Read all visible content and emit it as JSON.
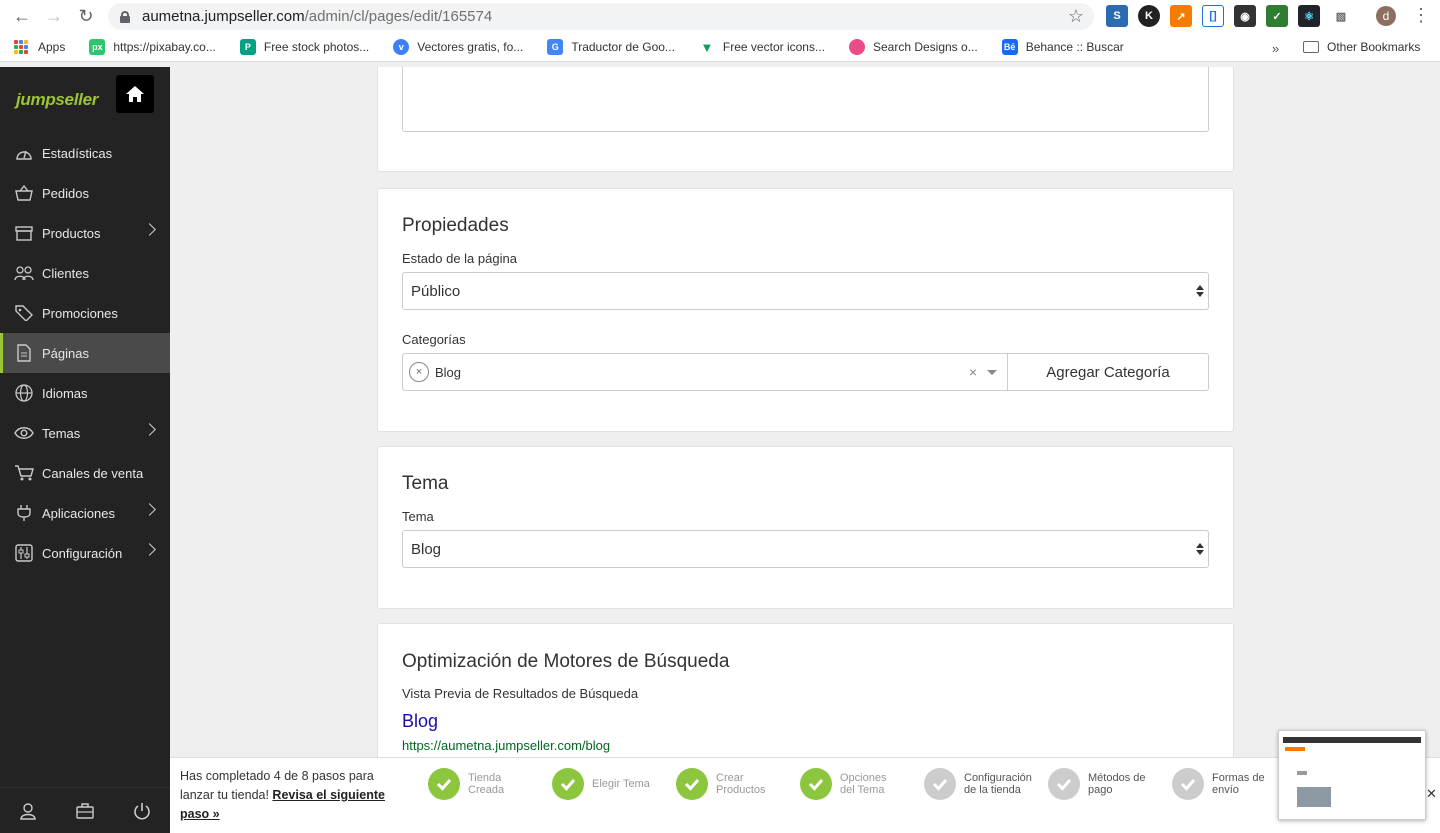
{
  "browser": {
    "url_host": "aumetna.jumpseller.com",
    "url_path": "/admin/cl/pages/edit/165574",
    "profile_initial": "d",
    "bookmarks": [
      {
        "label": "Apps"
      },
      {
        "label": "https://pixabay.co..."
      },
      {
        "label": "Free stock photos..."
      },
      {
        "label": "Vectores gratis, fo..."
      },
      {
        "label": "Traductor de Goo..."
      },
      {
        "label": "Free vector icons..."
      },
      {
        "label": "Search Designs o..."
      },
      {
        "label": "Behance :: Buscar"
      }
    ],
    "other_bookmarks": "Other Bookmarks",
    "more": "»"
  },
  "sidebar": {
    "logo": "jumpseller",
    "items": [
      {
        "label": "Estadísticas",
        "icon": "dashboard-icon"
      },
      {
        "label": "Pedidos",
        "icon": "basket-icon"
      },
      {
        "label": "Productos",
        "icon": "box-icon"
      },
      {
        "label": "Clientes",
        "icon": "users-icon"
      },
      {
        "label": "Promociones",
        "icon": "tag-icon"
      },
      {
        "label": "Páginas",
        "icon": "page-icon"
      },
      {
        "label": "Idiomas",
        "icon": "globe-icon"
      },
      {
        "label": "Temas",
        "icon": "eye-icon"
      },
      {
        "label": "Canales de venta",
        "icon": "cart-icon"
      },
      {
        "label": "Aplicaciones",
        "icon": "plug-icon"
      },
      {
        "label": "Configuración",
        "icon": "settings-icon"
      }
    ]
  },
  "properties": {
    "title": "Propiedades",
    "status_label": "Estado de la página",
    "status_value": "Público",
    "categories_label": "Categorías",
    "category_tag": "Blog",
    "add_category": "Agregar Categoría"
  },
  "theme": {
    "title": "Tema",
    "label": "Tema",
    "value": "Blog"
  },
  "seo": {
    "title": "Optimización de Motores de Búsqueda",
    "preview_label": "Vista Previa de Resultados de Búsqueda",
    "preview_title": "Blog",
    "preview_url": "https://aumetna.jumpseller.com/blog"
  },
  "progress": {
    "text_prefix": "Has completado 4 de 8 pasos para lanzar tu tienda! ",
    "link": "Revisa el siguiente paso »",
    "steps": [
      {
        "line1": "Tienda",
        "line2": "Creada",
        "done": true
      },
      {
        "line1": "Elegir Tema",
        "line2": "",
        "done": true
      },
      {
        "line1": "Crear",
        "line2": "Productos",
        "done": true
      },
      {
        "line1": "Opciones",
        "line2": "del Tema",
        "done": true
      },
      {
        "line1": "Configuración",
        "line2": "de la tienda",
        "done": false
      },
      {
        "line1": "Métodos de",
        "line2": "pago",
        "done": false
      },
      {
        "line1": "Formas de",
        "line2": "envío",
        "done": false
      }
    ],
    "colors": {
      "done": "#8cc63f",
      "pending": "#cccccc"
    }
  }
}
